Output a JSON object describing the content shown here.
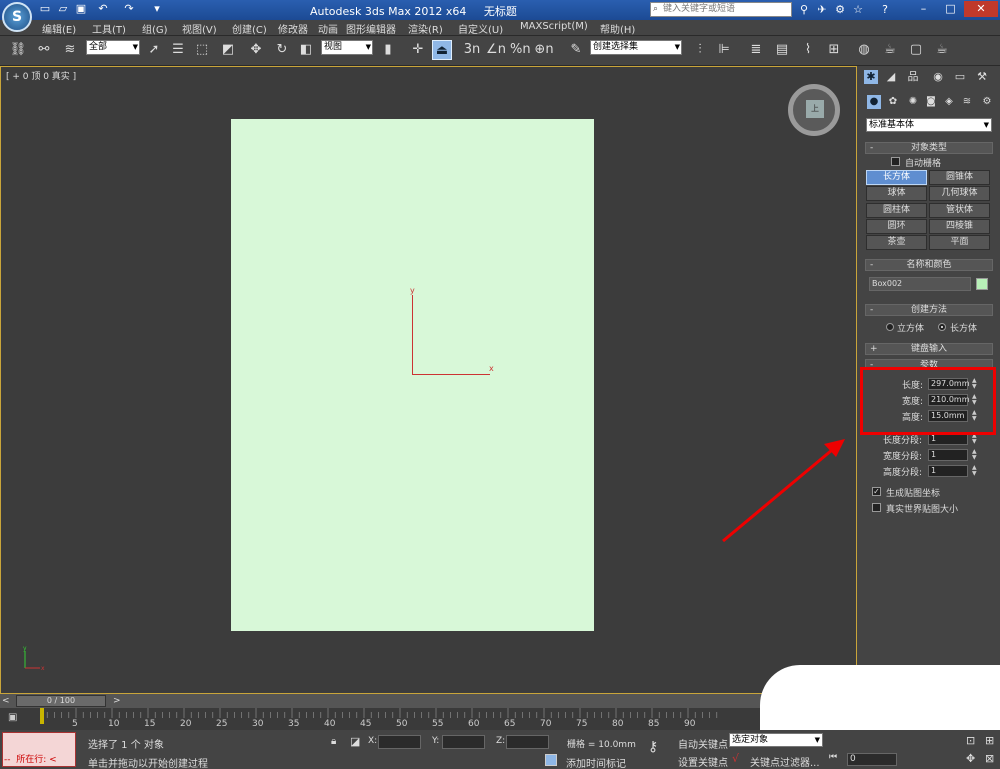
{
  "title_bar": {
    "app_title": "Autodesk 3ds Max  2012 x64",
    "file_title": "无标题",
    "search_placeholder": "键入关键字或短语",
    "app_logo_glyph": "S"
  },
  "menu": [
    "编辑(E)",
    "工具(T)",
    "组(G)",
    "视图(V)",
    "创建(C)",
    "修改器",
    "动画",
    "图形编辑器",
    "渲染(R)",
    "自定义(U)",
    "MAXScript(M)",
    "帮助(H)"
  ],
  "toolbar": {
    "selection_filter": "全部",
    "reference_coord": "视图",
    "named_selection": "创建选择集",
    "snap_labels": [
      "3n",
      "∠n",
      "%n",
      "⊕n"
    ]
  },
  "viewport": {
    "label": "[ + 0 顶 0 真实 ]",
    "axis_x": "x",
    "axis_y": "y",
    "viewcube_face": "上",
    "paper_color": "#d8f8d8",
    "border_color": "#c9a53a"
  },
  "command_panel": {
    "category": "标准基本体",
    "object_type": {
      "title": "对象类型",
      "autogrid": "自动栅格",
      "buttons": [
        "长方体",
        "圆锥体",
        "球体",
        "几何球体",
        "圆柱体",
        "管状体",
        "圆环",
        "四棱锥",
        "茶壶",
        "平面"
      ],
      "active": "长方体"
    },
    "name_color": {
      "title": "名称和颜色",
      "name": "Box002",
      "color": "#b8f0b8"
    },
    "creation_method": {
      "title": "创建方法",
      "options": [
        "立方体",
        "长方体"
      ],
      "selected": "长方体"
    },
    "keyboard_entry": {
      "title": "键盘输入"
    },
    "parameters": {
      "title": "参数",
      "length_label": "长度:",
      "length_value": "297.0mm",
      "width_label": "宽度:",
      "width_value": "210.0mm",
      "height_label": "高度:",
      "height_value": "15.0mm",
      "length_segs_label": "长度分段:",
      "length_segs_value": "1",
      "width_segs_label": "宽度分段:",
      "width_segs_value": "1",
      "height_segs_label": "高度分段:",
      "height_segs_value": "1",
      "gen_mapping": "生成贴图坐标",
      "real_world": "真实世界贴图大小"
    }
  },
  "timeline": {
    "frame_display": "0 / 100",
    "ticks": [
      "5",
      "10",
      "15",
      "20",
      "25",
      "30",
      "35",
      "40",
      "45",
      "50",
      "55",
      "60",
      "65",
      "70",
      "75",
      "80",
      "85",
      "90"
    ],
    "prev": "<",
    "next": ">"
  },
  "status": {
    "mini_listener": "所在行:",
    "selection_msg": "选择了 1 个 对象",
    "prompt_msg": "单击并拖动以开始创建过程",
    "x_label": "X:",
    "y_label": "Y:",
    "z_label": "Z:",
    "grid": "栅格 = 10.0mm",
    "add_time_tag": "添加时间标记",
    "auto_key": "自动关键点",
    "set_key": "设置关键点",
    "selected_dd": "选定对象",
    "key_filters": "关键点过滤器...",
    "frame_value": "0"
  },
  "annotation_color": "#e00000"
}
